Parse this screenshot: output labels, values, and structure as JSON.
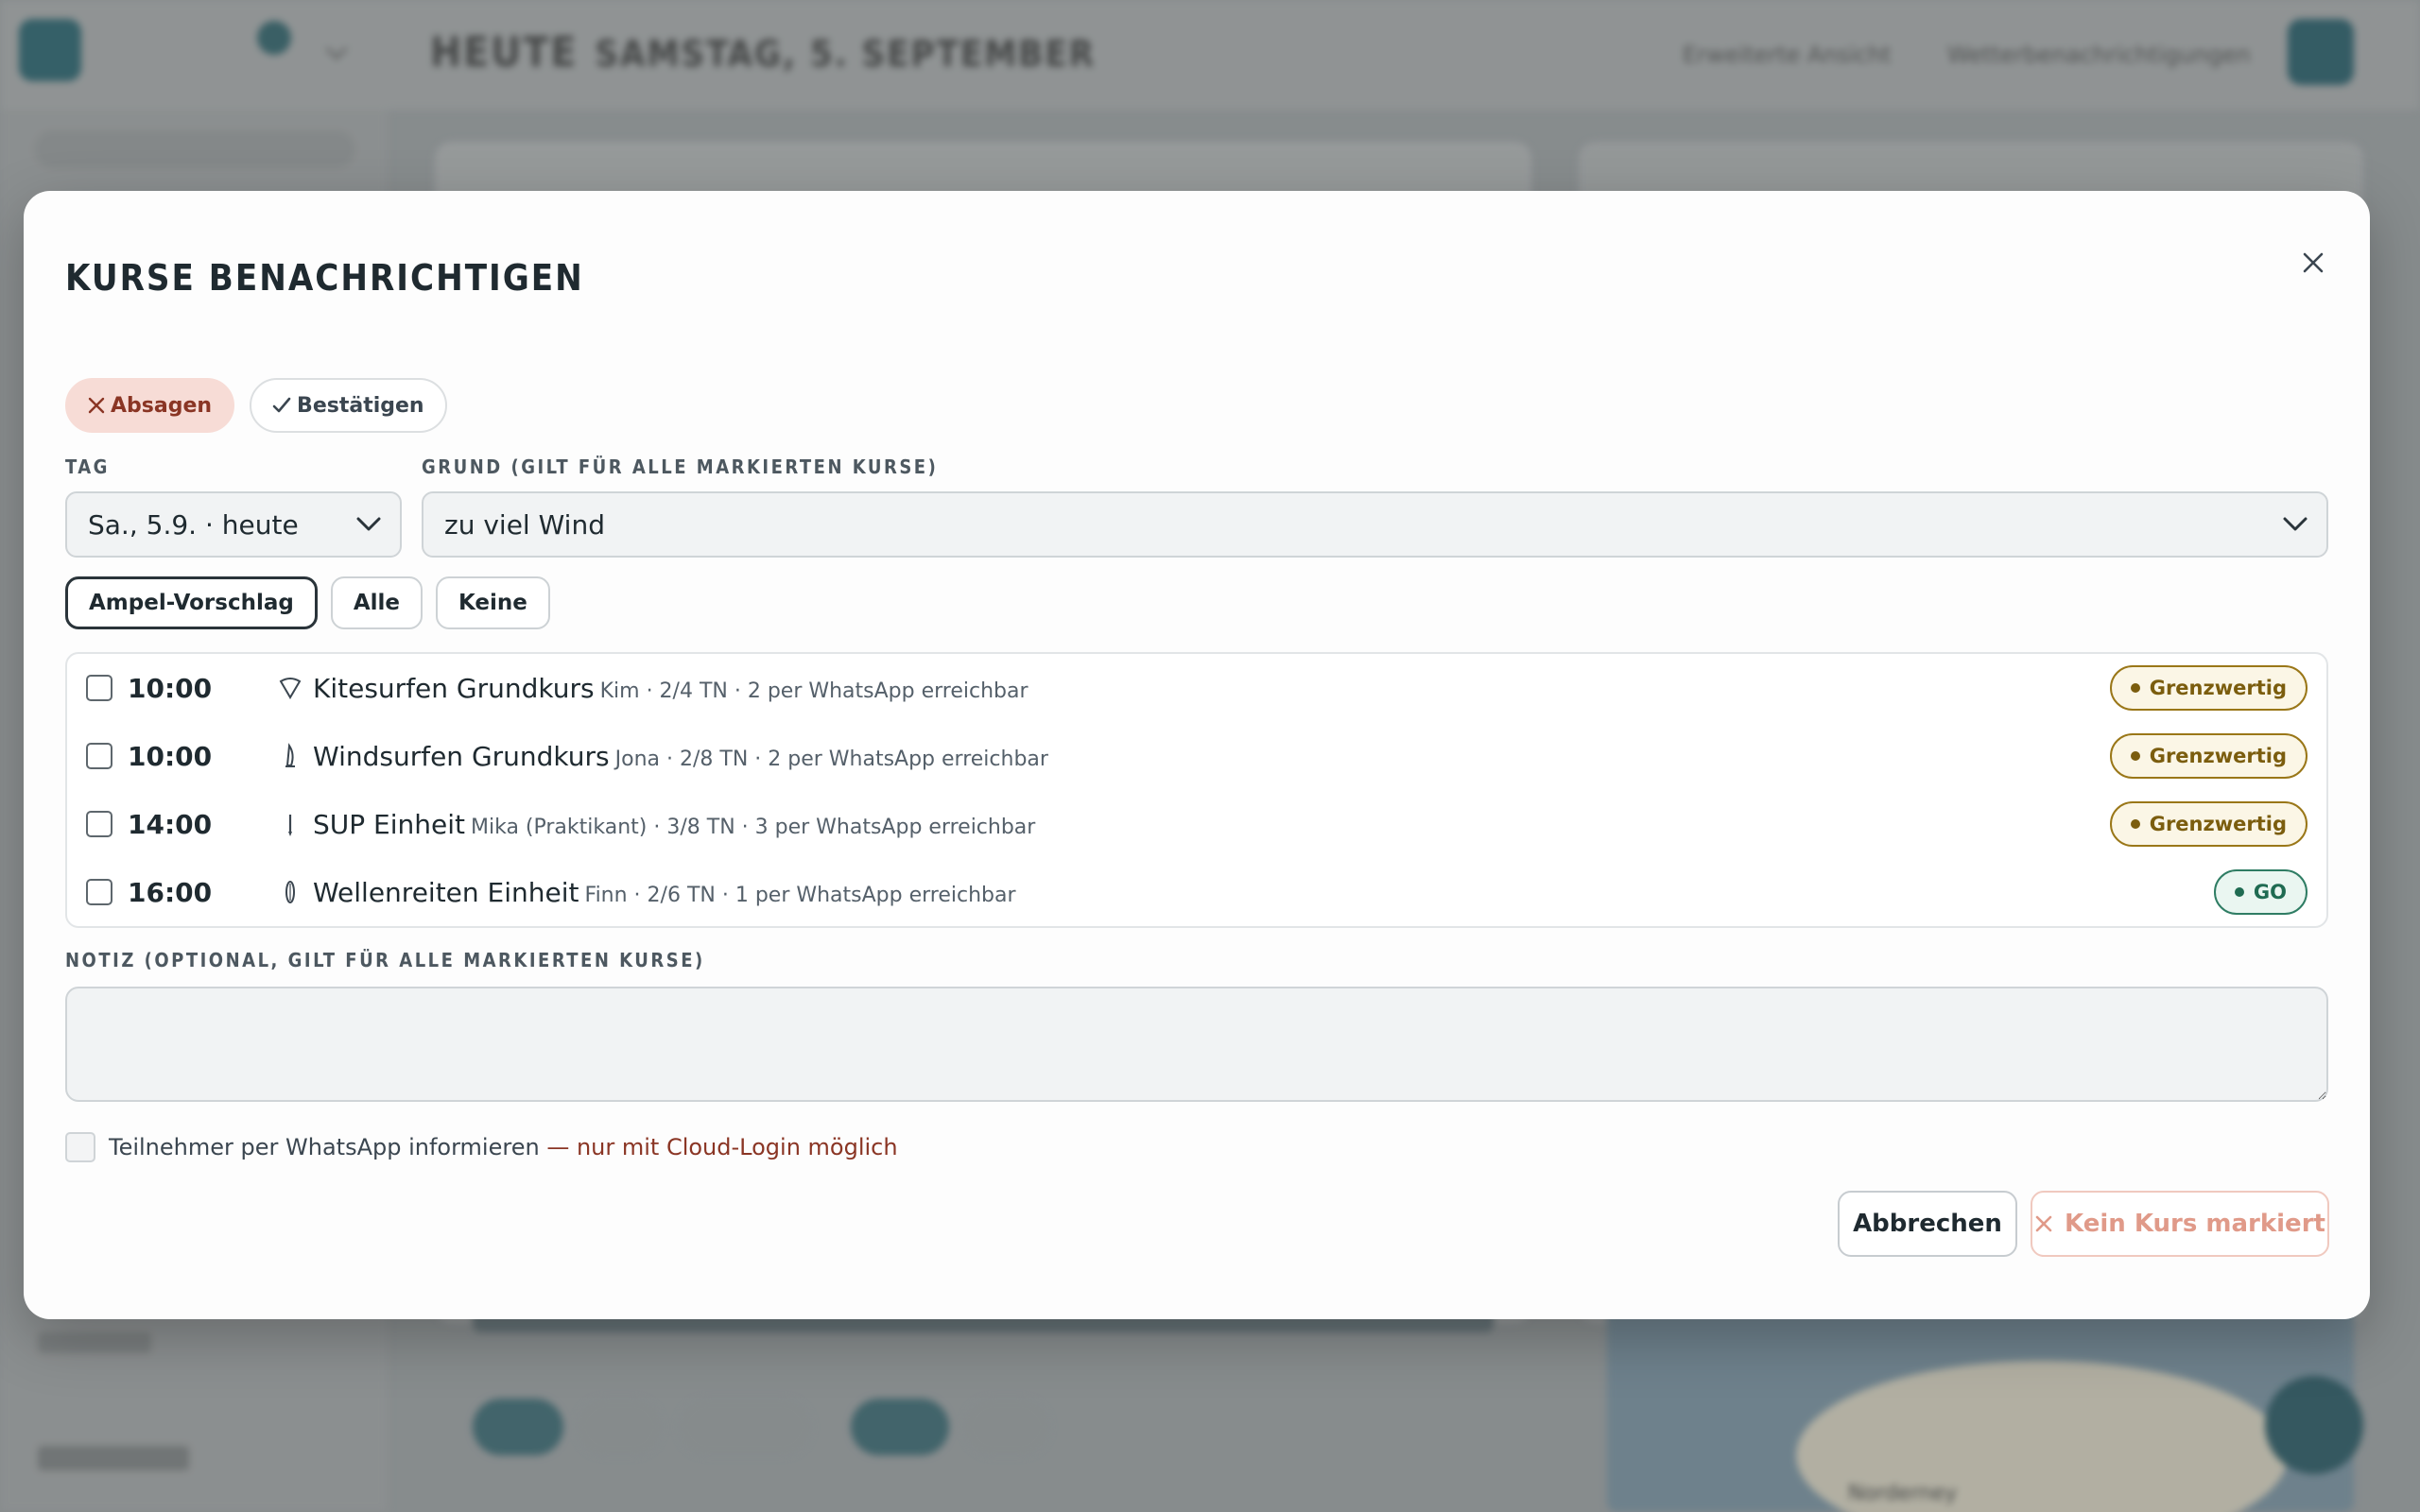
{
  "background": {
    "app_title": "HEUTE",
    "app_date": "SAMSTAG, 5. SEPTEMBER",
    "top_link_1": "Erweiterte Ansicht",
    "top_link_2": "Wetterbenachrichtigungen",
    "map_label": "Norderney"
  },
  "modal": {
    "title": "KURSE BENACHRICHTIGEN",
    "mode_cancel_label": "Absagen",
    "mode_confirm_label": "Bestätigen",
    "day_label": "TAG",
    "day_value": "Sa., 5.9. · heute",
    "reason_label": "GRUND (GILT FÜR ALLE MARKIERTEN KURSE)",
    "reason_value": "zu viel Wind",
    "filter_suggest": "Ampel-Vorschlag",
    "filter_all": "Alle",
    "filter_none": "Keine",
    "courses": [
      {
        "time": "10:00",
        "name": "Kitesurfen Grundkurs",
        "meta": "Kim · 2/4 TN · 2 per WhatsApp erreichbar",
        "status": "Grenzwertig",
        "icon": "kite-icon"
      },
      {
        "time": "10:00",
        "name": "Windsurfen Grundkurs",
        "meta": "Jona · 2/8 TN · 2 per WhatsApp erreichbar",
        "status": "Grenzwertig",
        "icon": "windsurf-sail-icon"
      },
      {
        "time": "14:00",
        "name": "SUP Einheit",
        "meta": "Mika (Praktikant) · 3/8 TN · 3 per WhatsApp erreichbar",
        "status": "Grenzwertig",
        "icon": "sup-paddle-icon"
      },
      {
        "time": "16:00",
        "name": "Wellenreiten Einheit",
        "meta": "Finn · 2/6 TN · 1 per WhatsApp erreichbar",
        "status": "GO",
        "icon": "surfboard-icon"
      }
    ],
    "note_label": "NOTIZ (OPTIONAL, GILT FÜR ALLE MARKIERTEN KURSE)",
    "note_value": "",
    "whatsapp_label": "Teilnehmer per WhatsApp informieren",
    "whatsapp_warning": "— nur mit Cloud-Login möglich",
    "cancel_button": "Abbrechen",
    "submit_button": "Kein Kurs markiert"
  },
  "colors": {
    "accent_cancel": "#8a3524",
    "status_warn": "#7b5d0e",
    "status_go": "#1f6b52"
  }
}
